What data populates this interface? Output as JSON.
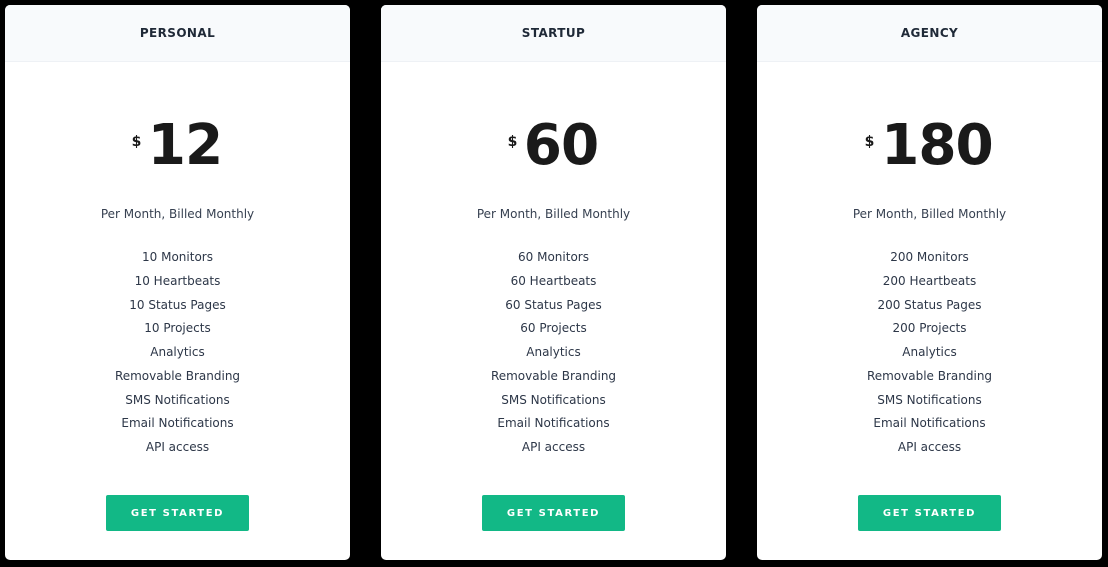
{
  "colors": {
    "background": "#000000",
    "card": "#ffffff",
    "header_bg": "#f8fafc",
    "accent": "#12b886",
    "text_dark": "#1a1a1a"
  },
  "plans": [
    {
      "name": "PERSONAL",
      "currency_symbol": "$",
      "price": "12",
      "billing": "Per Month, Billed Monthly",
      "features": [
        "10 Monitors",
        "10 Heartbeats",
        "10 Status Pages",
        "10 Projects",
        "Analytics",
        "Removable Branding",
        "SMS Notifications",
        "Email Notifications",
        "API access"
      ],
      "cta_label": "GET STARTED"
    },
    {
      "name": "STARTUP",
      "currency_symbol": "$",
      "price": "60",
      "billing": "Per Month, Billed Monthly",
      "features": [
        "60 Monitors",
        "60 Heartbeats",
        "60 Status Pages",
        "60 Projects",
        "Analytics",
        "Removable Branding",
        "SMS Notifications",
        "Email Notifications",
        "API access"
      ],
      "cta_label": "GET STARTED"
    },
    {
      "name": "AGENCY",
      "currency_symbol": "$",
      "price": "180",
      "billing": "Per Month, Billed Monthly",
      "features": [
        "200 Monitors",
        "200 Heartbeats",
        "200 Status Pages",
        "200 Projects",
        "Analytics",
        "Removable Branding",
        "SMS Notifications",
        "Email Notifications",
        "API access"
      ],
      "cta_label": "GET STARTED"
    }
  ]
}
